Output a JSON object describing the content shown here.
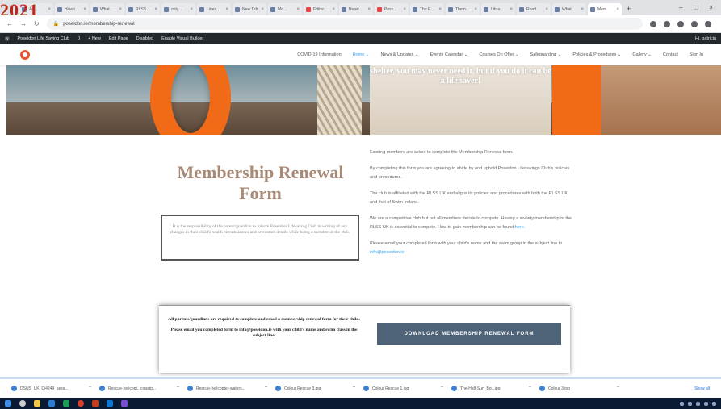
{
  "browser": {
    "tabs": [
      "Ari...",
      "How t...",
      "What...",
      "RLSS...",
      "only...",
      "Liner...",
      "New Tab",
      "Mo...",
      "Editor...",
      "Beaw...",
      "Poss...",
      "The R...",
      "Them...",
      "Libra...",
      "Road",
      "What...",
      "Mem"
    ],
    "url": "poseidon.ie/membership-renewal"
  },
  "overlay_text": {
    "year": "2021"
  },
  "wp_admin": {
    "items": [
      "Poseidon Life Saving Club",
      "0",
      "+ New",
      "Edit Page",
      "Disabled",
      "Enable Visual Builder"
    ],
    "right": "Hi, patricia"
  },
  "nav": {
    "links": [
      "COVID-19 Information",
      "Home ⌄",
      "News & Updates ⌄",
      "Events Calendar ⌄",
      "Courses On Offer ⌄",
      "Safeguarding ⌄",
      "Policies & Procedures ⌄",
      "Gallery ⌄",
      "Contact",
      "Sign In"
    ]
  },
  "hero": {
    "quote": "shelter, you may never need it, but if you do it can be a life saver!"
  },
  "page": {
    "title": "Membership Renewal Form",
    "notice": "It is the responsibility of the parent/guardian to inform Poseidon Lifesaving Club in writing of any changes in their child's health circumstances and or contact details while being a member of the club.",
    "paragraphs": [
      "Existing members are asked to complete the Membership Renewal form.",
      "By completing this form you are agreeing to abide by and uphold Poseidon Lifesavings Club's policies and procedures.",
      "The club is affiliated with the RLSS UK and aligns its policies and procedures with both the RLSS UK and that of Swim Ireland.",
      "We are a competitive club but not all members decide to compete. Having a society membership to the RLSS UK is essential to compete. How to gain membership can be found",
      "Please email your completed form with your child's name and the swim group in the subject line to"
    ],
    "link_here": "here.",
    "email_link": "info@poseidon.ie",
    "card_text_1": "All parents/guardians are required to complete and email a membership renewal form for their child.",
    "card_text_2": "Please email you completed form to info@poseidon.ie with your child's name and swim class in the subject line.",
    "download_button": "DOWNLOAD MEMBERSHIP RENEWAL FORM"
  },
  "downloads": {
    "items": [
      "DSUS_UK_Di4249_sess...",
      "Rescue-helicopt...coastg...",
      "Rescue-helicopter-waters...",
      "Colour Rescue 3.jpg",
      "Colour Rescue 1.jpg",
      "The-Half-Sun_Bg...jpg",
      "Colour 3.jpg"
    ],
    "show_all": "Show all"
  }
}
